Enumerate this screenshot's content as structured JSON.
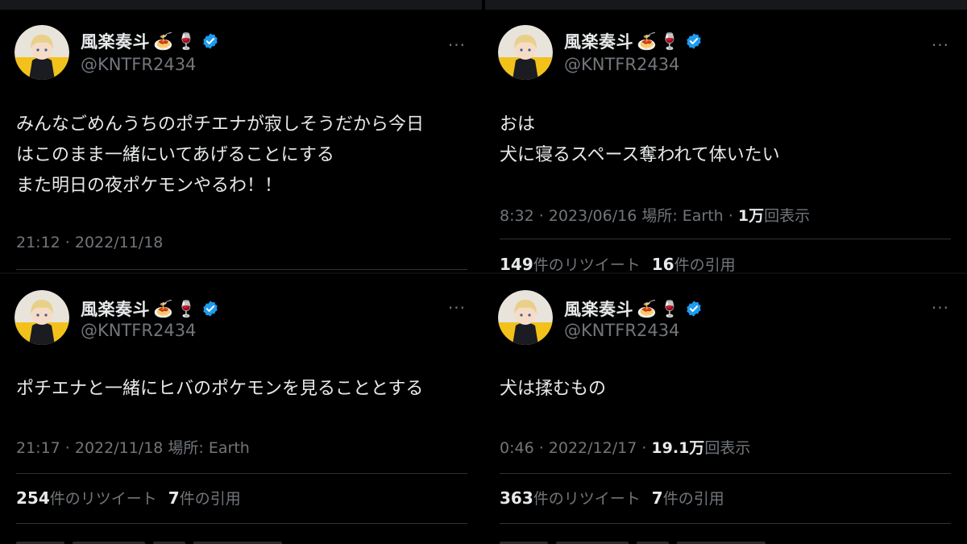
{
  "tweets": [
    {
      "name": "風楽奏斗",
      "emoji1": "🍝",
      "emoji2": "🍷",
      "handle": "@KNTFR2434",
      "more": "···",
      "text": "みんなごめんうちのポチエナが寂しそうだから今日\nはこのまま一緒にいてあげることにする\nまた明日の夜ポケモンやるわ！！",
      "meta": "21:12 · 2022/11/18"
    },
    {
      "name": "風楽奏斗",
      "emoji1": "🍝",
      "emoji2": "🍷",
      "handle": "@KNTFR2434",
      "more": "···",
      "text": "おは\n犬に寝るスペース奪われて体いたい",
      "meta_prefix": "8:32 · 2023/06/16 場所: Earth · ",
      "views_count": "1万",
      "views_label": "回表示",
      "retweets_count": "149",
      "retweets_label": "件のリツイート",
      "quotes_count": "16",
      "quotes_label": "件の引用"
    },
    {
      "name": "風楽奏斗",
      "emoji1": "🍝",
      "emoji2": "🍷",
      "handle": "@KNTFR2434",
      "more": "···",
      "text": "ポチエナと一緒にヒバのポケモンを見ることとする",
      "meta": "21:17 · 2022/11/18 場所: Earth",
      "retweets_count": "254",
      "retweets_label": "件のリツイート",
      "quotes_count": "7",
      "quotes_label": "件の引用"
    },
    {
      "name": "風楽奏斗",
      "emoji1": "🍝",
      "emoji2": "🍷",
      "handle": "@KNTFR2434",
      "more": "···",
      "text": "犬は揉むもの",
      "meta_prefix": "0:46 · 2022/12/17 · ",
      "views_count": "19.1万",
      "views_label": "回表示",
      "retweets_count": "363",
      "retweets_label": "件のリツイート",
      "quotes_count": "7",
      "quotes_label": "件の引用"
    }
  ],
  "colors": {
    "background": "#000000",
    "text": "#e7e9ea",
    "muted": "#71767b",
    "divider": "#2f3336",
    "verified": "#1d9bf0"
  }
}
